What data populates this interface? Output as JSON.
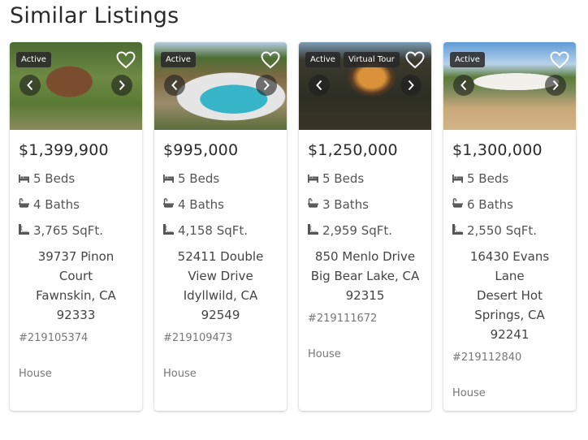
{
  "page": {
    "title": "Similar Listings"
  },
  "listings": [
    {
      "badges": [
        "Active"
      ],
      "price": "$1,399,900",
      "beds": "5 Beds",
      "baths": "4 Baths",
      "sqft": "3,765 SqFt.",
      "address_lines": [
        "39737 Pinon Court",
        "Fawnskin, CA 92333"
      ],
      "mls": "#219105374",
      "type": "House",
      "favorite": false
    },
    {
      "badges": [
        "Active"
      ],
      "price": "$995,000",
      "beds": "5 Beds",
      "baths": "4 Baths",
      "sqft": "4,158 SqFt.",
      "address_lines": [
        "52411 Double View Drive",
        "Idyllwild, CA 92549"
      ],
      "mls": "#219109473",
      "type": "House",
      "favorite": false
    },
    {
      "badges": [
        "Active",
        "Virtual Tour"
      ],
      "price": "$1,250,000",
      "beds": "5 Beds",
      "baths": "3 Baths",
      "sqft": "2,959 SqFt.",
      "address_lines": [
        "850 Menlo Drive",
        "Big Bear Lake, CA 92315"
      ],
      "mls": "#219111672",
      "type": "House",
      "favorite": false
    },
    {
      "badges": [
        "Active"
      ],
      "price": "$1,300,000",
      "beds": "5 Beds",
      "baths": "6 Baths",
      "sqft": "2,550 SqFt.",
      "address_lines": [
        "16430 Evans Lane",
        "Desert Hot Springs, CA 92241"
      ],
      "mls": "#219112840",
      "type": "House",
      "favorite": false
    }
  ],
  "icons": {
    "beds": "bed-icon",
    "baths": "bathtub-icon",
    "sqft": "ruler-icon",
    "favorite": "heart-outline-icon",
    "prev": "chevron-left-icon",
    "next": "chevron-right-icon"
  }
}
